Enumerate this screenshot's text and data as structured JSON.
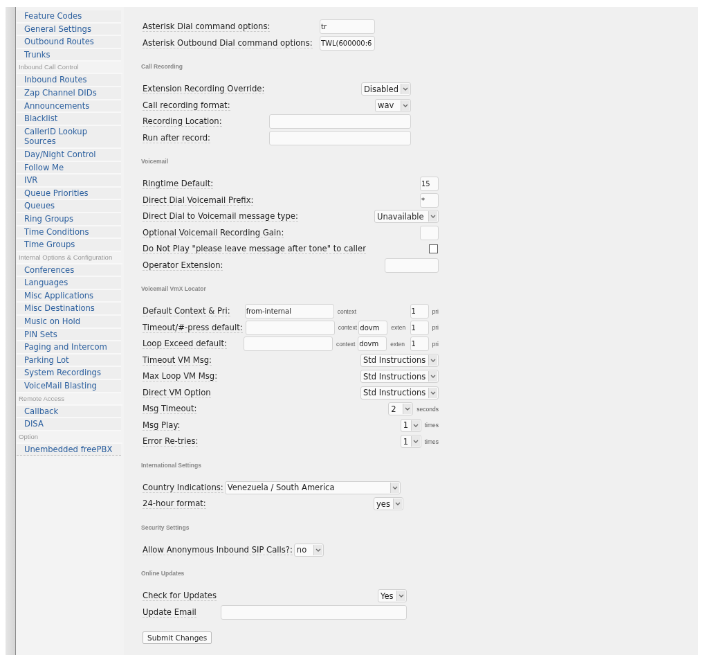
{
  "sidebar": {
    "items": [
      {
        "kind": "link",
        "label": "Feature Codes"
      },
      {
        "kind": "link",
        "label": "General Settings"
      },
      {
        "kind": "link",
        "label": "Outbound Routes"
      },
      {
        "kind": "link",
        "label": "Trunks"
      },
      {
        "kind": "heading",
        "label": "Inbound Call Control"
      },
      {
        "kind": "link",
        "label": "Inbound Routes"
      },
      {
        "kind": "link",
        "label": "Zap Channel DIDs"
      },
      {
        "kind": "link",
        "label": "Announcements"
      },
      {
        "kind": "link",
        "label": "Blacklist"
      },
      {
        "kind": "link",
        "label": "CallerID Lookup Sources"
      },
      {
        "kind": "link",
        "label": "Day/Night Control"
      },
      {
        "kind": "link",
        "label": "Follow Me"
      },
      {
        "kind": "link",
        "label": "IVR"
      },
      {
        "kind": "link",
        "label": "Queue Priorities"
      },
      {
        "kind": "link",
        "label": "Queues"
      },
      {
        "kind": "link",
        "label": "Ring Groups"
      },
      {
        "kind": "link",
        "label": "Time Conditions"
      },
      {
        "kind": "link",
        "label": "Time Groups"
      },
      {
        "kind": "heading",
        "label": "Internal Options & Configuration"
      },
      {
        "kind": "link",
        "label": "Conferences"
      },
      {
        "kind": "link",
        "label": "Languages"
      },
      {
        "kind": "link",
        "label": "Misc Applications"
      },
      {
        "kind": "link",
        "label": "Misc Destinations"
      },
      {
        "kind": "link",
        "label": "Music on Hold"
      },
      {
        "kind": "link",
        "label": "PIN Sets"
      },
      {
        "kind": "link",
        "label": "Paging and Intercom"
      },
      {
        "kind": "link",
        "label": "Parking Lot"
      },
      {
        "kind": "link",
        "label": "System Recordings"
      },
      {
        "kind": "link",
        "label": "VoiceMail Blasting"
      },
      {
        "kind": "heading",
        "label": "Remote Access"
      },
      {
        "kind": "link",
        "label": "Callback"
      },
      {
        "kind": "link",
        "label": "DISA"
      },
      {
        "kind": "heading",
        "label": "Option"
      },
      {
        "kind": "link",
        "label": "Unembedded freePBX"
      }
    ]
  },
  "sections": [
    {
      "rows": [
        {
          "kind": "input",
          "label": "Asterisk Dial command options:",
          "value": "tr"
        },
        {
          "kind": "input",
          "label": "Asterisk Outbound Dial command options:",
          "value": "TWL(600000:6"
        }
      ]
    },
    {
      "heading": "Call Recording",
      "rows": [
        {
          "kind": "select",
          "label": "Extension Recording Override:",
          "value": "Disabled"
        },
        {
          "kind": "select",
          "label": "Call recording format:",
          "value": "wav"
        },
        {
          "kind": "input",
          "label": "Recording Location:"
        },
        {
          "kind": "input",
          "label": "Run after record:"
        }
      ]
    },
    {
      "heading": "Voicemail",
      "rows": [
        {
          "kind": "input",
          "label": "Ringtime Default:",
          "value": "15"
        },
        {
          "kind": "input",
          "label": "Direct Dial Voicemail Prefix:",
          "value": "*"
        },
        {
          "kind": "select",
          "label": "Direct Dial to Voicemail message type:",
          "value": "Unavailable"
        },
        {
          "kind": "input",
          "label": "Optional Voicemail Recording Gain:"
        },
        {
          "kind": "checkbox",
          "label": "Do Not Play \"please leave message after tone\" to caller",
          "checked": false
        },
        {
          "kind": "input",
          "label": "Operator Extension:"
        }
      ]
    },
    {
      "heading": "Voicemail VmX Locator",
      "rows": [
        {
          "kind": "locator",
          "label": "Default Context & Pri:",
          "context": "from-internal",
          "context_label": "context",
          "pri": "1",
          "pri_label": "pri"
        },
        {
          "kind": "locator",
          "label": "Timeout/#-press default:",
          "context_label": "context",
          "exten": "dovm",
          "exten_label": "exten",
          "pri": "1",
          "pri_label": "pri"
        },
        {
          "kind": "locator",
          "label": "Loop Exceed default:",
          "context_label": "context",
          "exten": "dovm",
          "exten_label": "exten",
          "pri": "1",
          "pri_label": "pri"
        },
        {
          "kind": "select",
          "label": "Timeout VM Msg:",
          "value": "Std Instructions"
        },
        {
          "kind": "select",
          "label": "Max Loop VM Msg:",
          "value": "Std Instructions"
        },
        {
          "kind": "select",
          "label": "Direct VM Option",
          "value": "Std Instructions"
        },
        {
          "kind": "select",
          "label": "Msg Timeout:",
          "value": "2",
          "unit": "seconds"
        },
        {
          "kind": "select",
          "label": "Msg Play:",
          "value": "1",
          "unit": "times"
        },
        {
          "kind": "select",
          "label": "Error Re-tries:",
          "value": "1",
          "unit": "times"
        }
      ]
    },
    {
      "heading": "International Settings",
      "rows": [
        {
          "kind": "select",
          "label": "Country Indications:",
          "value": "Venezuela / South America"
        },
        {
          "kind": "select",
          "label": "24-hour format:",
          "value": "yes"
        }
      ]
    },
    {
      "heading": "Security Settings",
      "rows": [
        {
          "kind": "select",
          "label": "Allow Anonymous Inbound SIP Calls?:",
          "value": "no"
        }
      ]
    },
    {
      "heading": "Online Updates",
      "rows": [
        {
          "kind": "select",
          "label": "Check for Updates",
          "value": "Yes"
        },
        {
          "kind": "input",
          "label": "Update Email"
        }
      ]
    }
  ],
  "submit": "Submit Changes"
}
